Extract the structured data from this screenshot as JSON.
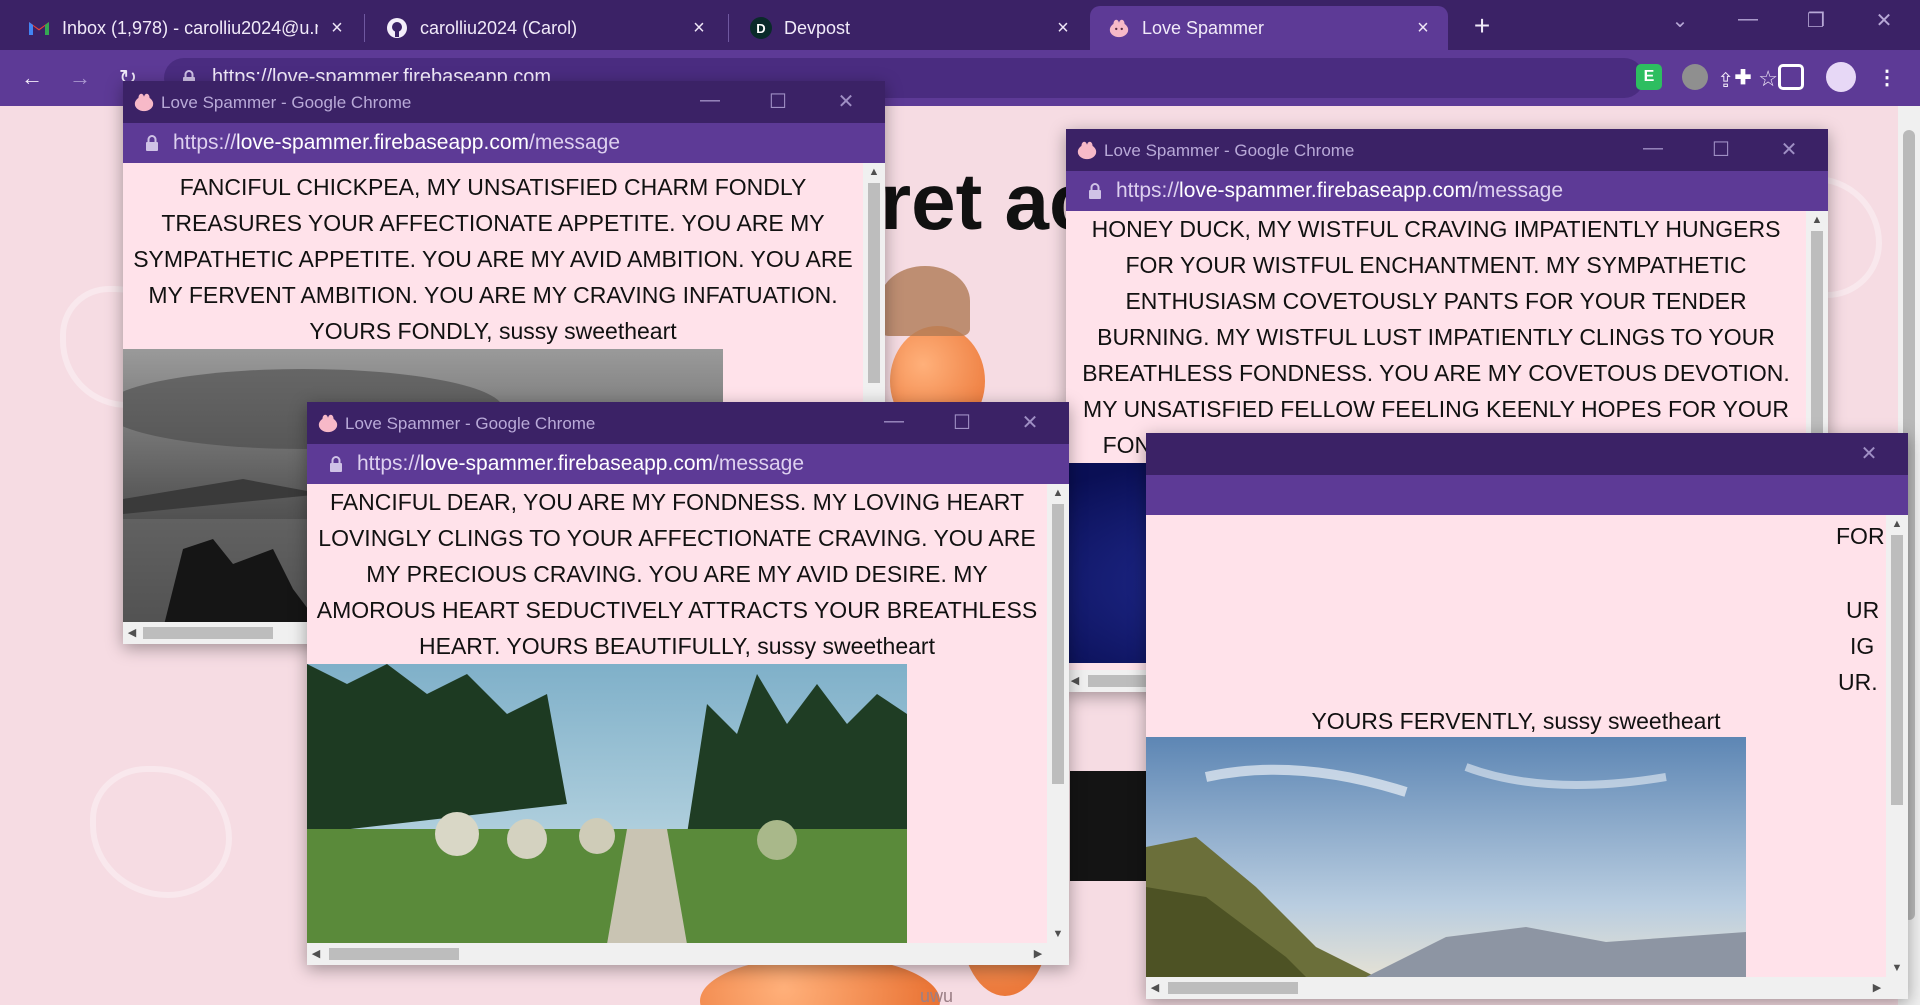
{
  "tabs": [
    {
      "title": "Inbox (1,978) - carolliu2024@u.n",
      "icon": "gmail-icon"
    },
    {
      "title": "carolliu2024 (Carol)",
      "icon": "github-icon"
    },
    {
      "title": "Devpost",
      "icon": "devpost-icon",
      "icon_letter": "D"
    },
    {
      "title": "Love Spammer",
      "icon": "love-spammer-icon"
    }
  ],
  "omnibox": {
    "url": "https://love-spammer.firebaseapp.com"
  },
  "extensions": [
    {
      "name": "evernote-extension-icon",
      "label": "E"
    }
  ],
  "page": {
    "title": "ret ac",
    "footer_text": "uwu"
  },
  "popups": [
    {
      "title": "Love Spammer - Google Chrome",
      "url_scheme": "https://",
      "url_host": "love-spammer.firebaseapp.com",
      "url_path": "/message",
      "message": "FANCIFUL CHICKPEA, MY UNSATISFIED CHARM FONDLY TREASURES YOUR AFFECTIONATE APPETITE. YOU ARE MY SYMPATHETIC APPETITE. YOU ARE MY AVID AMBITION. YOU ARE MY FERVENT AMBITION. YOU ARE MY CRAVING INFATUATION. YOURS FONDLY, sussy sweetheart",
      "image": "stormy-coast-photo"
    },
    {
      "title": "Love Spammer - Google Chrome",
      "url_scheme": "https://",
      "url_host": "love-spammer.firebaseapp.com",
      "url_path": "/message",
      "message": "HONEY DUCK, MY WISTFUL CRAVING IMPATIENTLY HUNGERS FOR YOUR WISTFUL ENCHANTMENT. MY SYMPATHETIC ENTHUSIASM COVETOUSLY PANTS FOR YOUR TENDER BURNING. MY WISTFUL LUST IMPATIENTLY CLINGS TO YOUR BREATHLESS FONDNESS. YOU ARE MY COVETOUS DEVOTION. MY UNSATISFIED FELLOW FEELING KEENLY HOPES FOR YOUR FONDEST AMBITION. YOURS BEAUTIFULLY, sussy sweetheart",
      "image": "fireworks-photo"
    },
    {
      "fragments": [
        "FOR",
        "UR",
        "IG",
        "UR."
      ],
      "message_tail": "YOURS FERVENTLY, sussy sweetheart",
      "image": "mountain-valley-photo"
    },
    {
      "title": "Love Spammer - Google Chrome",
      "url_scheme": "https://",
      "url_host": "love-spammer.firebaseapp.com",
      "url_path": "/message",
      "message": "FANCIFUL DEAR, YOU ARE MY FONDNESS. MY LOVING HEART LOVINGLY CLINGS TO YOUR AFFECTIONATE CRAVING. YOU ARE MY PRECIOUS CRAVING. YOU ARE MY AVID DESIRE. MY AMOROUS HEART SEDUCTIVELY ATTRACTS YOUR BREATHLESS HEART. YOURS BEAUTIFULLY, sussy sweetheart",
      "image": "forest-path-photo"
    }
  ]
}
